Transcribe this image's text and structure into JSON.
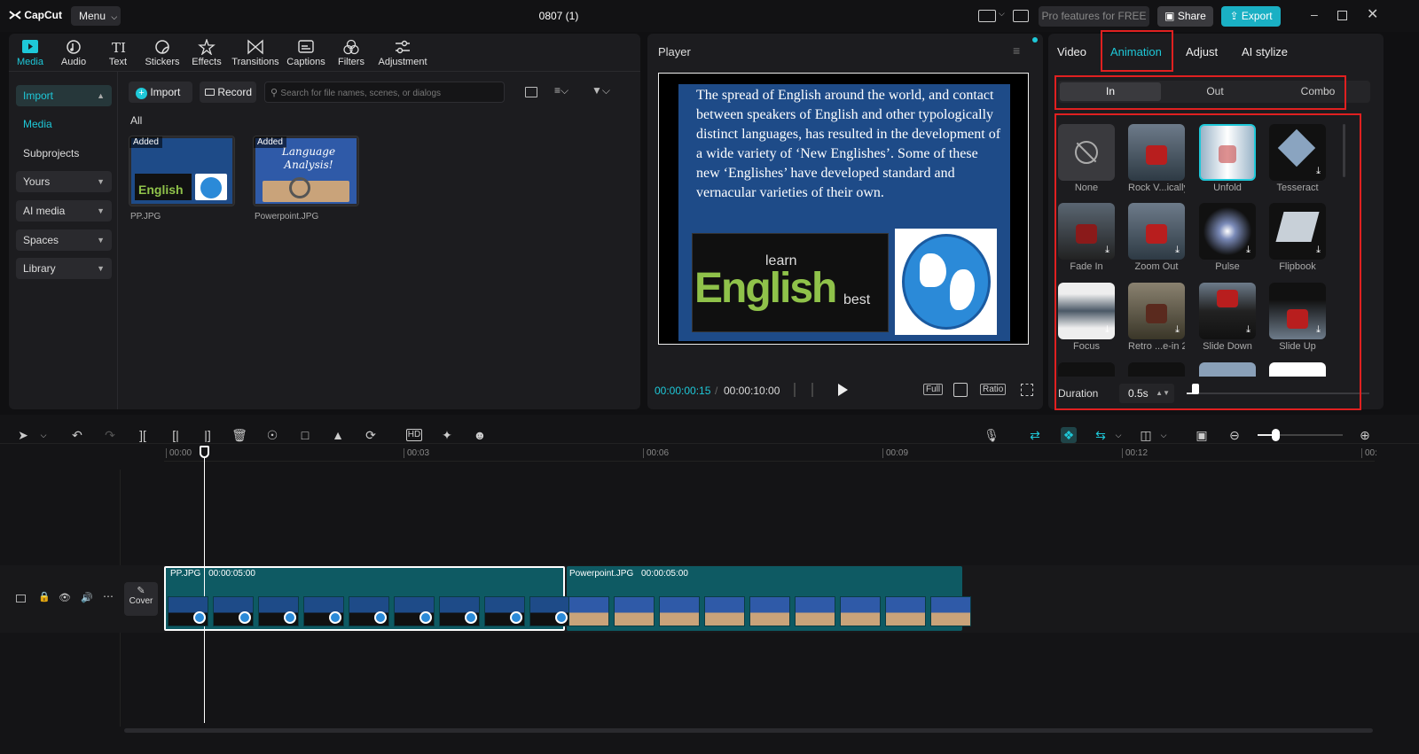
{
  "app": {
    "name": "CapCut",
    "menu_label": "Menu",
    "project_title": "0807 (1)"
  },
  "titlebar": {
    "pro_label": "Pro features for FREE",
    "share_label": "Share",
    "export_label": "Export"
  },
  "toolbar": {
    "items": [
      {
        "label": "Media",
        "icon": "media-icon"
      },
      {
        "label": "Audio",
        "icon": "audio-icon"
      },
      {
        "label": "Text",
        "icon": "text-icon"
      },
      {
        "label": "Stickers",
        "icon": "stickers-icon"
      },
      {
        "label": "Effects",
        "icon": "effects-icon"
      },
      {
        "label": "Transitions",
        "icon": "transitions-icon"
      },
      {
        "label": "Captions",
        "icon": "captions-icon"
      },
      {
        "label": "Filters",
        "icon": "filters-icon"
      },
      {
        "label": "Adjustment",
        "icon": "adjustment-icon"
      }
    ]
  },
  "sidebar": {
    "items": [
      {
        "label": "Import"
      },
      {
        "label": "Media"
      },
      {
        "label": "Subprojects"
      },
      {
        "label": "Yours"
      },
      {
        "label": "AI media"
      },
      {
        "label": "Spaces"
      },
      {
        "label": "Library"
      }
    ]
  },
  "media": {
    "import_label": "Import",
    "record_label": "Record",
    "search_placeholder": "Search for file names, scenes, or dialogs",
    "filter_label": "All",
    "added_badge": "Added",
    "files": [
      {
        "name": "PP.JPG"
      },
      {
        "name": "Powerpoint.JPG"
      }
    ],
    "thumb_text": "Language Analysis!"
  },
  "player": {
    "title": "Player",
    "slide_text": "The spread of English around the world, and contact between speakers of English and other typologically distinct languages, has resulted in the development of a wide variety of ‘New Englishes’. Some of these new ‘Englishes’ have developed standard and vernacular varieties of their own.",
    "wordcloud_main": "English",
    "wordcloud_words": [
      "learn",
      "best"
    ],
    "current_time": "00:00:00:15",
    "total_time": "00:00:10:00",
    "full_label": "Full",
    "ratio_label": "Ratio"
  },
  "properties": {
    "tabs": [
      {
        "label": "Video"
      },
      {
        "label": "Animation"
      },
      {
        "label": "Adjust"
      },
      {
        "label": "AI stylize"
      }
    ],
    "active_tab": "Animation",
    "subtabs": [
      {
        "label": "In"
      },
      {
        "label": "Out"
      },
      {
        "label": "Combo"
      }
    ],
    "animations": [
      {
        "label": "None"
      },
      {
        "label": "Rock V...ically"
      },
      {
        "label": "Unfold"
      },
      {
        "label": "Tesseract"
      },
      {
        "label": "Fade In"
      },
      {
        "label": "Zoom Out"
      },
      {
        "label": "Pulse"
      },
      {
        "label": "Flipbook"
      },
      {
        "label": "Focus"
      },
      {
        "label": "Retro ...e-in 2"
      },
      {
        "label": "Slide Down"
      },
      {
        "label": "Slide Up"
      }
    ],
    "duration_label": "Duration",
    "duration_value": "0.5s",
    "duration_fraction": 0.05
  },
  "timeline": {
    "ruler_labels": [
      "00:00",
      "00:03",
      "00:06",
      "00:09",
      "00:12",
      "00:"
    ],
    "cover_label": "Cover",
    "clips": [
      {
        "name": "PP.JPG",
        "duration": "00:00:05:00"
      },
      {
        "name": "Powerpoint.JPG",
        "duration": "00:00:05:00"
      }
    ]
  },
  "colors": {
    "accent": "#1ec8d8",
    "highlight_box": "#e02020",
    "clip_bg": "#0e5a63",
    "export_bg": "#1ab0c4"
  }
}
